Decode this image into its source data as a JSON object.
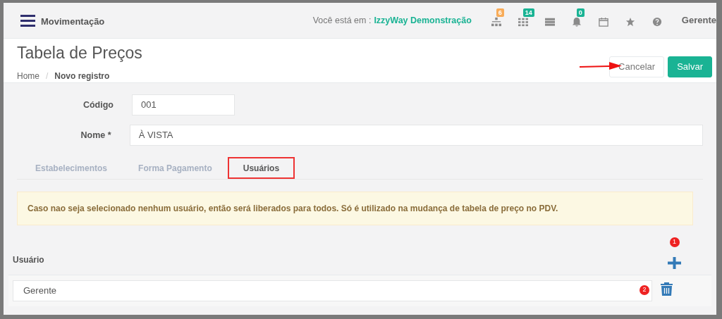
{
  "topbar": {
    "menu_title": "Movimentação",
    "location_label": "Você está em :",
    "location_value": "IzzyWay Demonstração",
    "icons": [
      {
        "kind": "sitemap",
        "badge": "6",
        "color": "#f8ac59"
      },
      {
        "kind": "grid",
        "badge": "14",
        "color": "#1ab394"
      },
      {
        "kind": "server"
      },
      {
        "kind": "bell",
        "badge": "0",
        "color": "#1ab394"
      },
      {
        "kind": "calendar"
      },
      {
        "kind": "star"
      },
      {
        "kind": "help"
      }
    ],
    "user": "Gerente"
  },
  "header": {
    "title": "Tabela de Preços",
    "breadcrumb": [
      "Home",
      "Novo registro"
    ],
    "breadcrumb_separator": "/",
    "buttons": [
      {
        "label": "Cancelar",
        "kind": "default"
      },
      {
        "label": "Salvar",
        "kind": "primary"
      }
    ]
  },
  "form": {
    "fields": [
      {
        "label": "Código",
        "value": "001",
        "kind": "short"
      },
      {
        "label": "Nome *",
        "value": "À VISTA",
        "kind": "wide"
      }
    ]
  },
  "tabs": [
    {
      "label": "Estabelecimentos",
      "selected": false,
      "highlighted": false
    },
    {
      "label": "Forma Pagamento",
      "selected": false,
      "highlighted": false
    },
    {
      "label": "Usuários",
      "selected": true,
      "highlighted": true
    }
  ],
  "alert": "Caso nao seja selecionado nenhum usuário, então será liberados para todos. Só é utilizado na mudança de tabela de preço no PDV.",
  "users": {
    "heading": "Usuário",
    "add_marker": "1",
    "rows": [
      {
        "value": "Gerente",
        "marker": "2"
      }
    ]
  }
}
